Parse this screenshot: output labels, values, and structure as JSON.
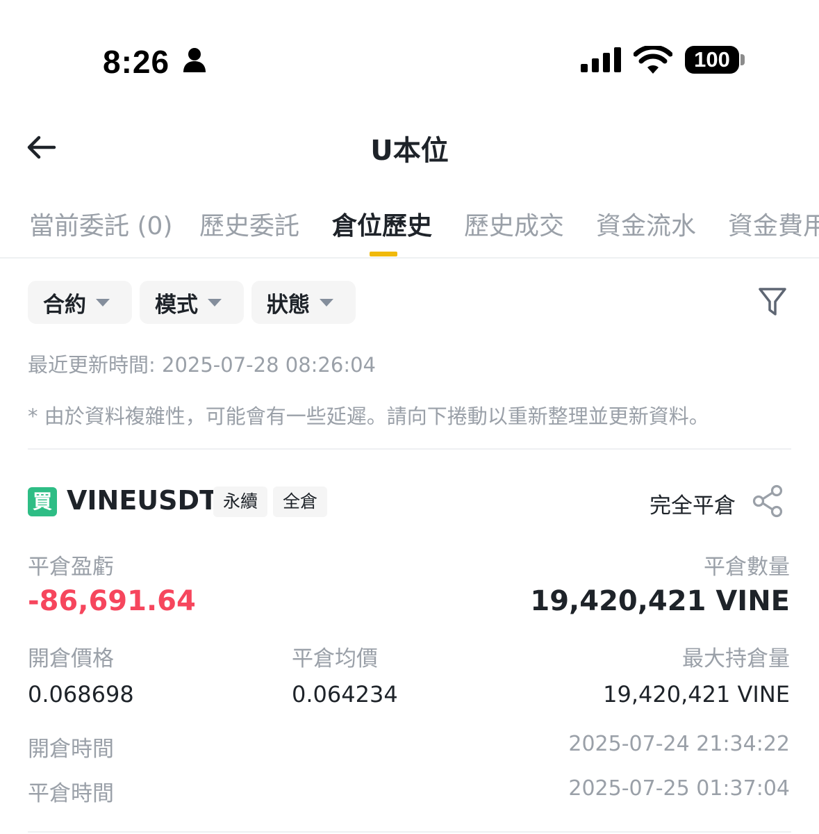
{
  "status_bar": {
    "time": "8:26",
    "battery": "100",
    "icons": [
      "person-icon",
      "cellular-signal-icon",
      "wifi-icon",
      "battery-icon"
    ]
  },
  "header": {
    "title": "U本位",
    "back_icon": "arrow-left-icon"
  },
  "tabs": [
    {
      "label": "當前委託 (0)",
      "active": false
    },
    {
      "label": "歷史委託",
      "active": false
    },
    {
      "label": "倉位歷史",
      "active": true
    },
    {
      "label": "歷史成交",
      "active": false
    },
    {
      "label": "資金流水",
      "active": false
    },
    {
      "label": "資金費用",
      "active": false
    }
  ],
  "filters": {
    "chips": [
      {
        "label": "合約"
      },
      {
        "label": "模式"
      },
      {
        "label": "狀態"
      }
    ],
    "filter_icon": "funnel-icon"
  },
  "notes": {
    "update_time": "最近更新時間: 2025-07-28 08:26:04",
    "delay_note": "* 由於資料複雜性，可能會有一些延遲。請向下捲動以重新整理並更新資料。"
  },
  "position": {
    "side_badge": "買",
    "symbol": "VINEUSDT",
    "tags": [
      "永續",
      "全倉"
    ],
    "close_status": "完全平倉",
    "share_icon": "share-icon",
    "pnl_label": "平倉盈虧",
    "pnl_value": "-86,691.64",
    "close_qty_label": "平倉數量",
    "close_qty_value": "19,420,421 VINE",
    "open_price_label": "開倉價格",
    "open_price_value": "0.068698",
    "close_avg_label": "平倉均價",
    "close_avg_value": "0.064234",
    "max_hold_label": "最大持倉量",
    "max_hold_value": "19,420,421 VINE",
    "open_time_label": "開倉時間",
    "open_time_value": "2025-07-24 21:34:22",
    "close_time_label": "平倉時間",
    "close_time_value": "2025-07-25 01:37:04"
  },
  "colors": {
    "accent": "#f0b90b",
    "buy": "#2ebd85",
    "loss": "#f6465d",
    "muted": "#9aa0a8",
    "text": "#1e2329"
  }
}
